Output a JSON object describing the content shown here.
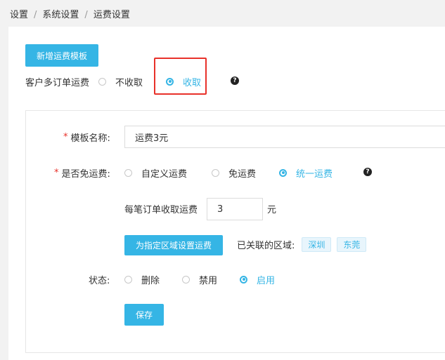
{
  "breadcrumb": [
    "设置",
    "系统设置",
    "运费设置"
  ],
  "add_template_button": "新增运费模板",
  "multi_order": {
    "label": "客户多订单运费",
    "options": [
      "不收取",
      "收取"
    ],
    "selected": 1
  },
  "template_name": {
    "label": "模板名称:",
    "value": "运费3元"
  },
  "free_shipping": {
    "label": "是否免运费:",
    "options": [
      "自定义运费",
      "免运费",
      "统一运费"
    ],
    "selected": 2
  },
  "per_order": {
    "label": "每笔订单收取运费",
    "value": "3",
    "unit": "元"
  },
  "region_button": "为指定区域设置运费",
  "linked_regions": {
    "label": "已关联的区域:",
    "tags": [
      "深圳",
      "东莞"
    ]
  },
  "status": {
    "label": "状态:",
    "options": [
      "删除",
      "禁用",
      "启用"
    ],
    "selected": 2
  },
  "save_button": "保存",
  "help_glyph": "?",
  "accent_color": "#35b5e5",
  "highlight_color": "#e8312a"
}
